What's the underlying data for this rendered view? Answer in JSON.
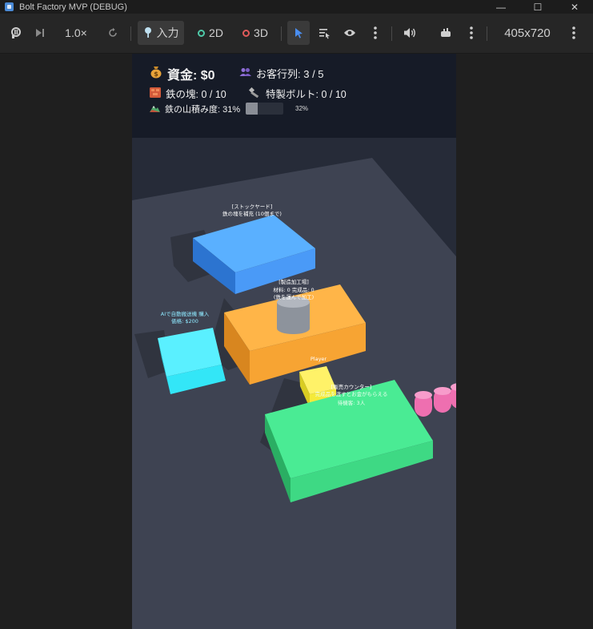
{
  "window": {
    "title": "Bolt Factory MVP (DEBUG)",
    "controls": {
      "minimize": "—",
      "maximize": "☐",
      "close": "✕"
    }
  },
  "toolbar": {
    "speed": "1.0×",
    "input_label": "入力",
    "mode_2d": "2D",
    "mode_3d": "3D",
    "resolution": "405x720",
    "colors": {
      "accent": "#4a8ef0",
      "mode_2d_dot": "#4ec9a8",
      "mode_3d_dot": "#e05a5a"
    }
  },
  "hud": {
    "money": "資金: $0",
    "queue": "お客行列: 3 / 5",
    "iron": "鉄の塊: 0 / 10",
    "bolt": "特製ボルト: 0 / 10",
    "pile": "鉄の山積み度: 31%",
    "pile_percent_label": "32%",
    "pile_fraction": 0.31
  },
  "scene": {
    "stockyard_title": "[ストックヤード]",
    "stockyard_sub": "鉄の塊を補充 (10個まで)",
    "factory_title": "[製造加工場]",
    "factory_line1": "材料: 0 完成品: 0",
    "factory_line2": "(鉄を運んで加工)",
    "cyan_line1": "AIで自動搬送機 購入",
    "cyan_line2": "価格: $200",
    "yellow_label": "Player",
    "counter_title": "[販売カウンター]",
    "counter_line1": "完成品を渡すとお金がもらえる",
    "counter_line2": "待機客: 3人",
    "colors": {
      "floor": "#3e4352",
      "blue_box": "#4a9af7",
      "orange_box": "#f7a433",
      "cyan_box": "#33e6f7",
      "green_box": "#3ed984",
      "yellow_box": "#f5ea3a",
      "customer": "#ee6fb0"
    }
  }
}
